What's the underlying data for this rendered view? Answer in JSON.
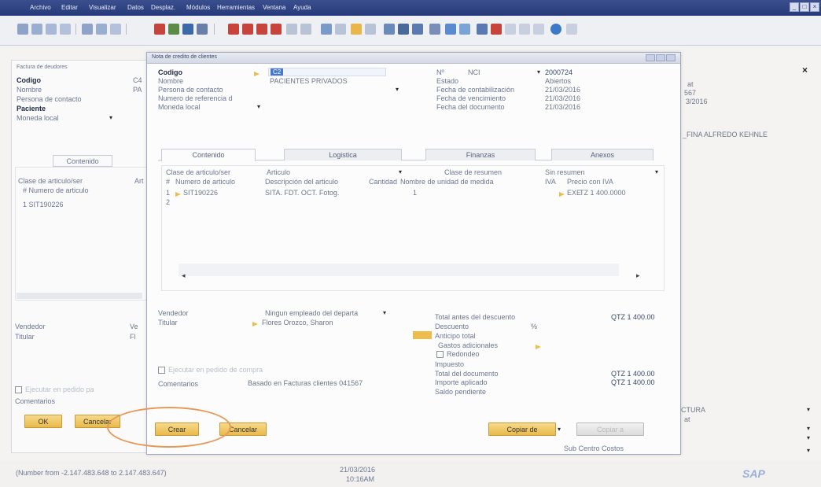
{
  "menubar": [
    "Archivo",
    "Editar",
    "Visualizar",
    "Datos",
    "Desplaz.",
    "Módulos",
    "Herramientas",
    "Ventana",
    "Ayuda"
  ],
  "bg_window": {
    "title": "Factura de deudores",
    "fields": [
      {
        "label": "Codigo",
        "value": "C4"
      },
      {
        "label": "Nombre",
        "value": "PA"
      },
      {
        "label": "Persona de contacto",
        "value": ""
      },
      {
        "label": "Paciente",
        "value": ""
      },
      {
        "label": "Moneda local",
        "value": "▾"
      }
    ],
    "tab": "Contenido",
    "col1": "Clase de articulo/ser",
    "col1b": "Art",
    "col_num": "#  Numero de articulo",
    "row1": "1   SIT190226",
    "vendedor": "Vendedor",
    "vendedor_val": "Ve",
    "titular": "Titular",
    "titular_val": "Fl",
    "comentarios": "Comentarios",
    "checkbox_text": "Ejecutar en pedido pa",
    "ok": "OK",
    "cancel": "Cancelar"
  },
  "right_bg": {
    "line1": "at",
    "line2": "567",
    "line3": "3/2016",
    "name": "_FINA ALFREDO KEHNLE",
    "tura": "CTURA",
    "at2": "at",
    "close": "×"
  },
  "dialog": {
    "title": "Nota de credito de clientes",
    "left_fields": [
      {
        "label": "Codigo",
        "value": "C2"
      },
      {
        "label": "Nombre",
        "value": "PACIENTES PRIVADOS"
      },
      {
        "label": "Persona de contacto",
        "value": ""
      },
      {
        "label": "Numero de referencia d",
        "value": ""
      },
      {
        "label": "Moneda local",
        "value": ""
      }
    ],
    "right_fields": [
      {
        "label": "Nº",
        "value": "NCI",
        "value2": "2000724"
      },
      {
        "label": "Estado",
        "value": "Abiertos"
      },
      {
        "label": "Fecha de contabilización",
        "value": "21/03/2016"
      },
      {
        "label": "Fecha de vencimiento",
        "value": "21/03/2016"
      },
      {
        "label": "Fecha del documento",
        "value": "21/03/2016"
      }
    ],
    "tabs": [
      "Contenido",
      "Logistica",
      "Finanzas",
      "Anexos"
    ],
    "item_class_label": "Clase de articulo/ser",
    "item_class_value": "Articulo",
    "summary_label": "Clase de resumen",
    "summary_value": "Sin resumen",
    "columns": [
      "#",
      "Numero de articulo",
      "Descripción del articulo",
      "Cantidad",
      "Nombre de unidad de medida",
      "IVA",
      "Precio con IVA"
    ],
    "rows": [
      {
        "num": "1",
        "code": "SIT190226",
        "desc": "SITA. FDT. OCT. Fotog.",
        "qty": "1",
        "iva": "EXE",
        "price": "TZ 1 400.0000"
      },
      {
        "num": "2",
        "code": "",
        "desc": "",
        "qty": "",
        "iva": "",
        "price": ""
      }
    ],
    "vendedor_label": "Vendedor",
    "vendedor_value": "Ningun empleado del departa",
    "titular_label": "Titular",
    "titular_value": "Flores Orozco, Sharon",
    "checkbox_text": "Ejecutar en pedido de compra",
    "comentarios_label": "Comentarios",
    "comentarios_value": "Basado en Facturas clientes 041567",
    "totals": [
      {
        "label": "Total antes del descuento",
        "value": "QTZ 1 400.00"
      },
      {
        "label": "Descuento",
        "value": "%"
      },
      {
        "label": "Anticipo total",
        "value": ""
      },
      {
        "label": "Gastos adicionales",
        "value": ""
      },
      {
        "label": "Redondeo",
        "value": ""
      },
      {
        "label": "Impuesto",
        "value": ""
      },
      {
        "label": "Total del documento",
        "value": "QTZ 1 400.00"
      },
      {
        "label": "Importe aplicado",
        "value": "QTZ 1 400.00"
      },
      {
        "label": "Saldo pendiente",
        "value": ""
      }
    ],
    "buttons": {
      "crear": "Crear",
      "cancelar": "Cancelar",
      "copiar": "Copiar de",
      "copiar_a": "Copiar a"
    },
    "subcentro": "Sub Centro Costos"
  },
  "statusbar": {
    "message": "(Number from -2.147.483.648 to 2.147.483.647)",
    "date": "21/03/2016",
    "time": "10:16AM",
    "logo": "SAP"
  },
  "colors": {
    "accent": "#ecbd4a",
    "title": "#26397a",
    "highlight": "#e69a5a"
  }
}
